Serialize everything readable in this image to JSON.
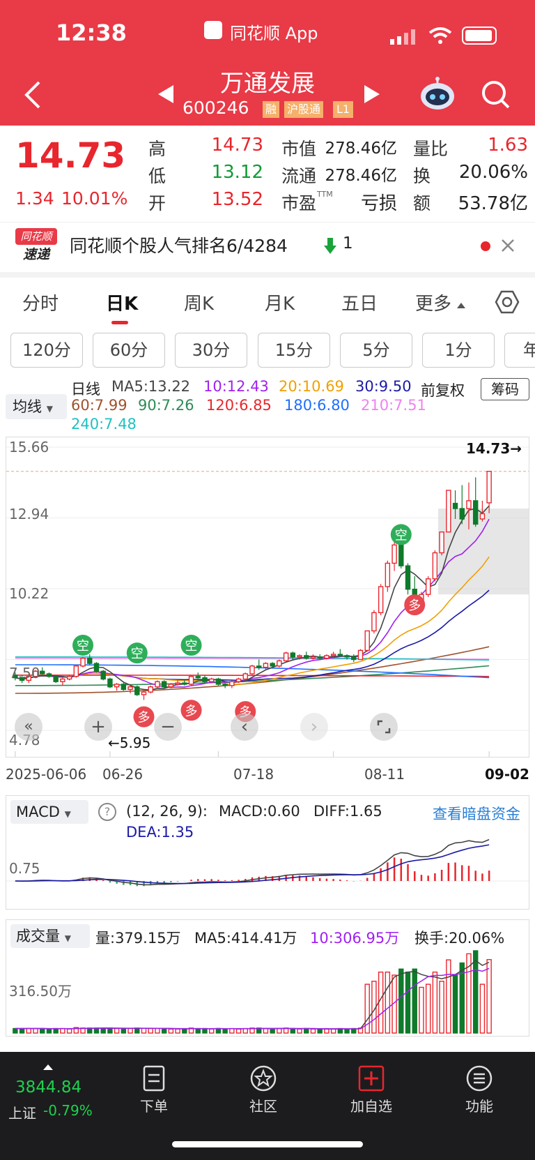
{
  "status_bar": {
    "time": "12:38",
    "app_label": "同花顺 App"
  },
  "header": {
    "title": "万通发展",
    "code": "600246",
    "badges": [
      "融",
      "沪股通",
      "L1"
    ]
  },
  "quote": {
    "price": "14.73",
    "change": "1.34",
    "change_pct": "10.01%",
    "high_label": "高",
    "high": "14.73",
    "low_label": "低",
    "low": "13.12",
    "open_label": "开",
    "open": "13.52",
    "mcap_label": "市值",
    "mcap": "278.46亿",
    "float_label": "流通",
    "float": "278.46亿",
    "pe_label": "市盈",
    "pe_sup": "TTM",
    "pe": "亏损",
    "vr_label": "量比",
    "vr": "1.63",
    "turnover_label": "换",
    "turnover": "20.06%",
    "amount_label": "额",
    "amount": "53.78亿"
  },
  "rank": {
    "logo_top": "同花顺",
    "logo_bottom": "速递",
    "text": "同花顺个股人气排名6/4284",
    "change": "1"
  },
  "tabs": [
    "分时",
    "日K",
    "周K",
    "月K",
    "五日",
    "更多"
  ],
  "active_tab": "日K",
  "periods": [
    "120分",
    "60分",
    "30分",
    "15分",
    "5分",
    "1分",
    "年"
  ],
  "ma_legend": {
    "selector": "均线",
    "line_type": "日线",
    "items": [
      {
        "text": "MA5:13.22",
        "color": "#444444"
      },
      {
        "text": "10:12.43",
        "color": "#a020f0"
      },
      {
        "text": "20:10.69",
        "color": "#f0a000"
      },
      {
        "text": "30:9.50",
        "color": "#1a1aa6"
      },
      {
        "text": "60:7.99",
        "color": "#a0522d"
      },
      {
        "text": "90:7.26",
        "color": "#2e8b57"
      },
      {
        "text": "120:6.85",
        "color": "#e8262d"
      },
      {
        "text": "180:6.80",
        "color": "#1e6fff"
      },
      {
        "text": "210:7.51",
        "color": "#ee82ee"
      },
      {
        "text": "240:7.48",
        "color": "#20c0c0"
      }
    ],
    "adjust": "前复权",
    "chip_button": "筹码"
  },
  "kline": {
    "y_labels": [
      "15.66",
      "12.94",
      "10.22",
      "7.50",
      "4.78"
    ],
    "x_labels": [
      "2025-06-06",
      "06-26",
      "07-18",
      "08-11",
      "09-02"
    ],
    "last_price_tag": "14.73→",
    "low_tag": "←5.95",
    "signals": {
      "short": "空",
      "long": "多"
    }
  },
  "macd": {
    "selector": "MACD",
    "params": "(12, 26, 9):",
    "macd": "MACD:0.60",
    "diff": "DIFF:1.65",
    "dea": "DEA:1.35",
    "link": "查看暗盘资金",
    "y_label": "0.75"
  },
  "volume": {
    "selector": "成交量",
    "vol": "量:379.15万",
    "ma5": "MA5:414.41万",
    "ma10": "10:306.95万",
    "turnover": "换手:20.06%",
    "y_label": "316.50万"
  },
  "bottom_nav": {
    "index_value": "3844.84",
    "index_name": "上证",
    "index_change": "-0.79%",
    "items": [
      "下单",
      "社区",
      "加自选",
      "功能"
    ]
  },
  "colors": {
    "brand_red": "#e93a47",
    "up": "#e8262d",
    "down": "#0f7a2a"
  },
  "chart_data": [
    {
      "type": "candlestick",
      "title": "日线",
      "x_range": [
        "2025-06-06",
        "09-02"
      ],
      "ylim": [
        4.78,
        15.66
      ],
      "ohlc_approx": [
        [
          6.9,
          7.0,
          6.7,
          6.8
        ],
        [
          6.8,
          6.9,
          6.6,
          6.7
        ],
        [
          6.7,
          6.9,
          6.6,
          6.85
        ],
        [
          6.85,
          7.1,
          6.8,
          7.05
        ],
        [
          7.05,
          7.2,
          6.9,
          6.95
        ],
        [
          6.95,
          7.0,
          6.8,
          6.85
        ],
        [
          6.85,
          6.9,
          6.6,
          6.65
        ],
        [
          6.65,
          6.8,
          6.5,
          6.75
        ],
        [
          6.75,
          6.9,
          6.7,
          6.85
        ],
        [
          6.85,
          7.3,
          6.8,
          7.25
        ],
        [
          7.25,
          7.6,
          7.2,
          7.55
        ],
        [
          7.55,
          7.7,
          7.3,
          7.35
        ],
        [
          7.35,
          7.4,
          7.0,
          7.05
        ],
        [
          7.05,
          7.1,
          6.7,
          6.75
        ],
        [
          6.75,
          6.8,
          6.4,
          6.45
        ],
        [
          6.45,
          6.6,
          6.3,
          6.55
        ],
        [
          6.55,
          6.6,
          6.3,
          6.35
        ],
        [
          6.35,
          6.5,
          6.2,
          6.45
        ],
        [
          6.45,
          6.5,
          6.1,
          6.15
        ],
        [
          6.15,
          6.3,
          5.95,
          6.25
        ],
        [
          6.25,
          6.5,
          6.2,
          6.45
        ],
        [
          6.45,
          6.7,
          6.4,
          6.65
        ],
        [
          6.65,
          6.7,
          6.4,
          6.45
        ],
        [
          6.45,
          6.6,
          6.4,
          6.55
        ],
        [
          6.55,
          6.7,
          6.5,
          6.6
        ],
        [
          6.6,
          6.7,
          6.5,
          6.55
        ],
        [
          6.55,
          6.9,
          6.5,
          6.85
        ],
        [
          6.85,
          7.0,
          6.7,
          6.8
        ],
        [
          6.8,
          6.9,
          6.6,
          6.65
        ],
        [
          6.65,
          6.8,
          6.6,
          6.75
        ],
        [
          6.75,
          6.8,
          6.5,
          6.55
        ],
        [
          6.55,
          6.6,
          6.4,
          6.5
        ],
        [
          6.5,
          6.7,
          6.4,
          6.65
        ],
        [
          6.65,
          6.8,
          6.6,
          6.75
        ],
        [
          6.75,
          7.0,
          6.7,
          6.95
        ],
        [
          6.95,
          7.3,
          6.9,
          7.25
        ],
        [
          7.25,
          7.5,
          7.1,
          7.2
        ],
        [
          7.2,
          7.4,
          7.1,
          7.35
        ],
        [
          7.35,
          7.4,
          7.2,
          7.25
        ],
        [
          7.25,
          7.5,
          7.2,
          7.45
        ],
        [
          7.45,
          7.8,
          7.4,
          7.75
        ],
        [
          7.75,
          7.8,
          7.5,
          7.6
        ],
        [
          7.6,
          7.7,
          7.5,
          7.65
        ],
        [
          7.65,
          7.8,
          7.5,
          7.55
        ],
        [
          7.55,
          7.7,
          7.5,
          7.6
        ],
        [
          7.6,
          7.7,
          7.5,
          7.55
        ],
        [
          7.55,
          7.7,
          7.5,
          7.65
        ],
        [
          7.65,
          7.8,
          7.6,
          7.7
        ],
        [
          7.7,
          7.9,
          7.6,
          7.65
        ],
        [
          7.65,
          7.7,
          7.5,
          7.6
        ],
        [
          7.6,
          7.7,
          7.4,
          7.5
        ],
        [
          7.5,
          7.9,
          7.5,
          7.85
        ],
        [
          7.85,
          8.6,
          7.8,
          8.6
        ],
        [
          8.6,
          9.4,
          8.5,
          9.3
        ],
        [
          9.3,
          10.4,
          9.2,
          10.3
        ],
        [
          10.3,
          11.3,
          10.1,
          11.2
        ],
        [
          11.2,
          12.0,
          10.9,
          11.9
        ],
        [
          11.9,
          12.3,
          11.0,
          11.1
        ],
        [
          11.1,
          11.2,
          10.0,
          10.2
        ],
        [
          10.2,
          10.7,
          9.4,
          9.5
        ],
        [
          9.5,
          10.1,
          9.4,
          10.0
        ],
        [
          10.0,
          10.7,
          9.9,
          10.6
        ],
        [
          10.6,
          11.7,
          10.5,
          11.6
        ],
        [
          11.6,
          12.4,
          11.5,
          12.4
        ],
        [
          12.4,
          14.0,
          12.4,
          14.0
        ],
        [
          13.5,
          14.0,
          12.9,
          13.3
        ],
        [
          13.3,
          14.2,
          12.7,
          12.9
        ],
        [
          13.3,
          14.3,
          12.5,
          13.6
        ],
        [
          13.6,
          14.5,
          12.6,
          12.7
        ],
        [
          12.9,
          13.6,
          12.8,
          13.1
        ],
        [
          13.52,
          14.73,
          13.12,
          14.73
        ]
      ]
    }
  ]
}
